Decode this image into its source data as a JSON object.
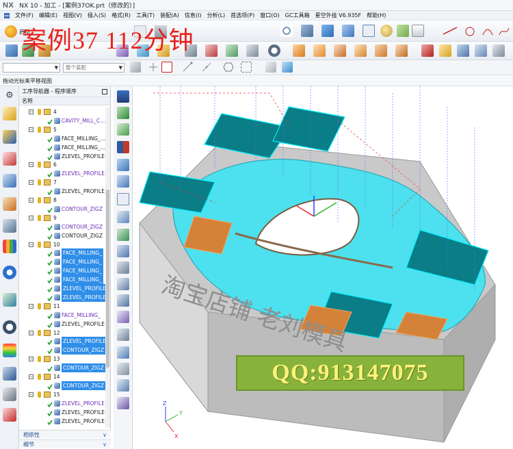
{
  "app": {
    "logo": "NX",
    "title": "NX 10 - 加工 - [案例37OK.prt（修改的）]"
  },
  "menu": {
    "items": [
      "文件(F)",
      "编辑(E)",
      "视图(V)",
      "插入(S)",
      "格式(R)",
      "工具(T)",
      "装配(A)",
      "信息(I)",
      "分析(L)",
      "首选项(P)",
      "窗口(O)",
      "GC工具箱",
      "星空外挂 V6.935F",
      "帮助(H)"
    ]
  },
  "toolbar": {
    "start_label": "启动",
    "filter_combo": "",
    "assembly_combo": "整个装配"
  },
  "overlay": {
    "watermark": "案例37  112分钟",
    "qq": "QQ:913147075"
  },
  "status": {
    "hint": "拖动光标来平移视图"
  },
  "navigator": {
    "title": "工序导航器 - 程序顺序",
    "column": "名称",
    "rows": [
      {
        "kind": "group",
        "label": "4"
      },
      {
        "kind": "op",
        "label": "CAVITY_MILL_C...",
        "purple": true,
        "sel": false
      },
      {
        "kind": "group",
        "label": "5"
      },
      {
        "kind": "op",
        "label": "FACE_MILLING_...",
        "purple": false,
        "sel": false
      },
      {
        "kind": "op",
        "label": "FACE_MILLING_...",
        "purple": false,
        "sel": false
      },
      {
        "kind": "op",
        "label": "ZLEVEL_PROFILE",
        "purple": false,
        "sel": false
      },
      {
        "kind": "group",
        "label": "6"
      },
      {
        "kind": "op",
        "label": "ZLEVEL_PROFILE",
        "purple": true,
        "sel": false
      },
      {
        "kind": "group",
        "label": "7"
      },
      {
        "kind": "op",
        "label": "ZLEVEL_PROFILE",
        "purple": false,
        "sel": false
      },
      {
        "kind": "group",
        "label": "8"
      },
      {
        "kind": "op",
        "label": "CONTOUR_ZIGZ",
        "purple": true,
        "sel": false
      },
      {
        "kind": "group",
        "label": "9"
      },
      {
        "kind": "op",
        "label": "CONTOUR_ZIGZ",
        "purple": true,
        "sel": false
      },
      {
        "kind": "op",
        "label": "CONTOUR_ZIGZ",
        "purple": false,
        "sel": false
      },
      {
        "kind": "group",
        "label": "10"
      },
      {
        "kind": "op",
        "label": "FACE_MILLING_",
        "purple": false,
        "sel": true
      },
      {
        "kind": "op",
        "label": "FACE_MILLING_",
        "purple": false,
        "sel": true
      },
      {
        "kind": "op",
        "label": "FACE_MILLING_",
        "purple": false,
        "sel": true
      },
      {
        "kind": "op",
        "label": "FACE_MILLING_",
        "purple": false,
        "sel": true
      },
      {
        "kind": "op",
        "label": "ZLEVEL_PROFILE",
        "purple": false,
        "sel": true
      },
      {
        "kind": "op",
        "label": "ZLEVEL_PROFILE",
        "purple": false,
        "sel": true
      },
      {
        "kind": "group",
        "label": "11"
      },
      {
        "kind": "op",
        "label": "FACE_MILLING_",
        "purple": true,
        "sel": false
      },
      {
        "kind": "op",
        "label": "ZLEVEL_PROFILE",
        "purple": false,
        "sel": false
      },
      {
        "kind": "group",
        "label": "12"
      },
      {
        "kind": "op",
        "label": "ZLEVEL_PROFILE",
        "purple": false,
        "sel": true
      },
      {
        "kind": "op",
        "label": "CONTOUR_ZIGZ",
        "purple": false,
        "sel": true
      },
      {
        "kind": "group",
        "label": "13"
      },
      {
        "kind": "op",
        "label": "CONTOUR_ZIGZ",
        "purple": false,
        "sel": true
      },
      {
        "kind": "group",
        "label": "14"
      },
      {
        "kind": "op",
        "label": "CONTOUR_ZIGZ",
        "purple": false,
        "sel": true
      },
      {
        "kind": "group",
        "label": "15"
      },
      {
        "kind": "op",
        "label": "ZLEVEL_PROFILE",
        "purple": true,
        "sel": false
      },
      {
        "kind": "op",
        "label": "ZLEVEL_PROFILE",
        "purple": false,
        "sel": false
      },
      {
        "kind": "op",
        "label": "ZLEVEL_PROFILE",
        "purple": false,
        "sel": false
      }
    ],
    "dependencies": "相依性",
    "details": "细节"
  },
  "viewport": {
    "engraving": "淘宝店铺  老刘模具",
    "axis_labels": {
      "x": "X",
      "y": "Y",
      "z": "Z"
    }
  },
  "colors": {
    "selection": "#2f8ee8",
    "purple_op": "#6a2bb6",
    "check": "#1a9e2a",
    "part_face": "#4de0ee",
    "part_side": "#d6d6d6",
    "floor": "#bfbfbf",
    "watermark": "#e8211b",
    "qq_bg": "#87b23c",
    "qq_text": "#fff17a"
  }
}
